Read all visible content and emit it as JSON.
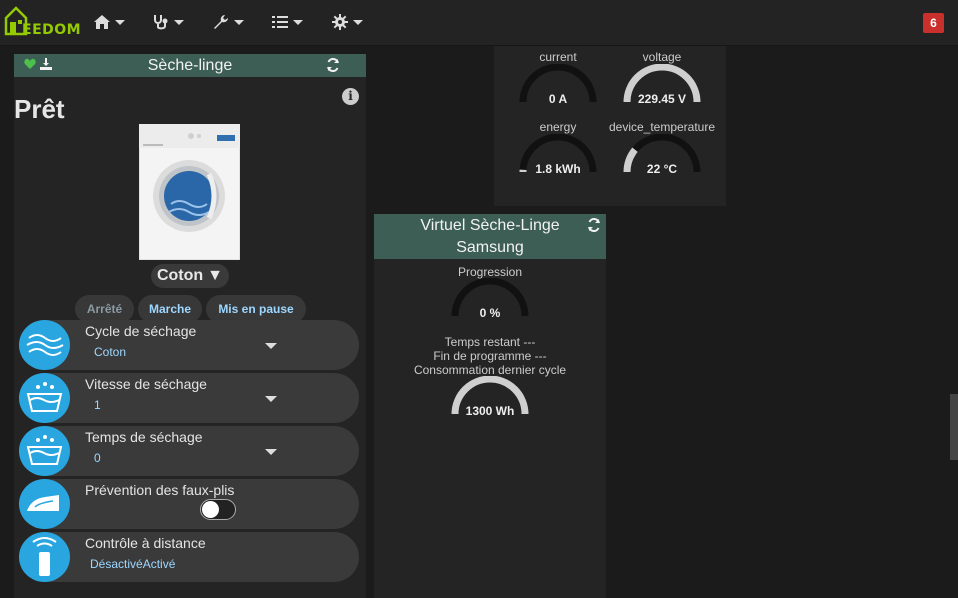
{
  "navbar": {
    "logo_text": "EEDOM",
    "menu": [
      {
        "icon": "home-icon"
      },
      {
        "icon": "stethoscope-icon"
      },
      {
        "icon": "wrench-icon"
      },
      {
        "icon": "tasks-icon"
      },
      {
        "icon": "gear-icon"
      }
    ],
    "notification_count": "6"
  },
  "dryer_widget": {
    "title": "Sèche-linge",
    "state": "Prêt",
    "program": "Coton",
    "program_caret": "▼",
    "buttons": {
      "stop": "Arrêté",
      "start": "Marche",
      "pause": "Mis en pause"
    },
    "rows": [
      {
        "label": "Cycle de séchage",
        "value": "Coton",
        "icon": "wind-icon"
      },
      {
        "label": "Vitesse de séchage",
        "value": "1",
        "icon": "basin-icon"
      },
      {
        "label": "Temps de séchage",
        "value": "0",
        "icon": "basin-icon"
      },
      {
        "label": "Prévention des faux-plis",
        "value": "",
        "icon": "iron-icon"
      },
      {
        "label": "Contrôle à distance",
        "value": "DésactivéActivé",
        "icon": "remote-icon"
      }
    ],
    "anti_crease_on": false
  },
  "power_widget": {
    "gauges": [
      {
        "label": "current",
        "value": "0 A",
        "fill": 0.0
      },
      {
        "label": "voltage",
        "value": "229.45 V",
        "fill": 1.0
      },
      {
        "label": "energy",
        "value": "1.8 kWh",
        "fill": 0.02
      },
      {
        "label": "device_temperature",
        "value": "22 °C",
        "fill": 0.22
      }
    ]
  },
  "virtual_widget": {
    "title_line1": "Virtuel Sèche-Linge",
    "title_line2": "Samsung",
    "progress_label": "Progression",
    "progress_value": "0 %",
    "progress_fill": 0.0,
    "remaining": "Temps restant ---",
    "end": "Fin de programme ---",
    "consumption_label": "Consommation dernier cycle",
    "consumption_value": "1300 Wh",
    "consumption_fill": 1.0
  },
  "colors": {
    "accent": "#29a6df",
    "header": "#3d5e55",
    "link": "#9dd7ff",
    "badge": "#c9302c"
  }
}
